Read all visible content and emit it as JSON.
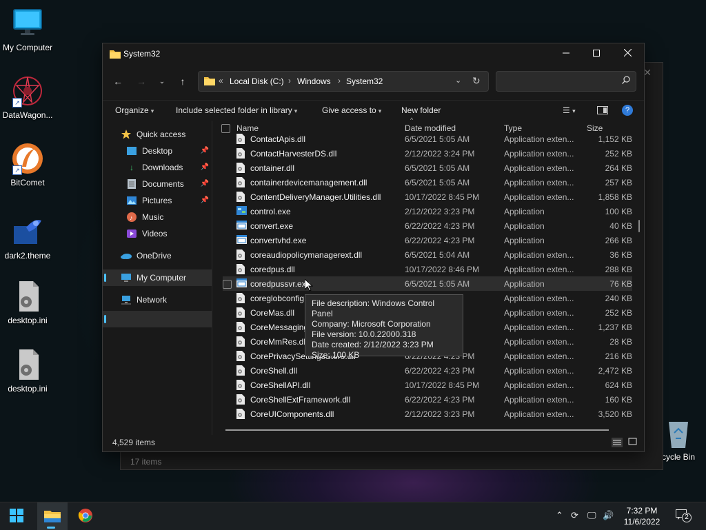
{
  "desktop": {
    "icons": [
      {
        "label": "My Computer",
        "icon": "monitor-icon"
      },
      {
        "label": "DataWagon...",
        "icon": "datawagon-icon"
      },
      {
        "label": "BitComet",
        "icon": "bitcomet-icon"
      },
      {
        "label": "dark2.theme",
        "icon": "theme-file-icon"
      },
      {
        "label": "desktop.ini",
        "icon": "settings-file-icon"
      },
      {
        "label": "desktop.ini",
        "icon": "settings-file-icon"
      },
      {
        "label": "cycle Bin",
        "icon": "recycle-bin-icon"
      }
    ]
  },
  "background_window": {
    "status": "17 items"
  },
  "window": {
    "title": "System32",
    "address": {
      "path": [
        "Local Disk (C:)",
        "Windows",
        "System32"
      ]
    },
    "search_placeholder": "",
    "commands": {
      "organize": "Organize",
      "include": "Include selected folder in library",
      "give_access": "Give access to",
      "new_folder": "New folder"
    },
    "sidebar": {
      "items": [
        {
          "label": "Quick access",
          "icon": "star-icon"
        },
        {
          "label": "Desktop",
          "icon": "desktop-icon",
          "pinned": true
        },
        {
          "label": "Downloads",
          "icon": "download-icon",
          "pinned": true
        },
        {
          "label": "Documents",
          "icon": "documents-icon",
          "pinned": true
        },
        {
          "label": "Pictures",
          "icon": "pictures-icon",
          "pinned": true
        },
        {
          "label": "Music",
          "icon": "music-icon"
        },
        {
          "label": "Videos",
          "icon": "videos-icon"
        },
        {
          "label": "OneDrive",
          "icon": "cloud-icon"
        },
        {
          "label": "My Computer",
          "icon": "computer-icon",
          "selected": true
        },
        {
          "label": "Network",
          "icon": "network-icon"
        }
      ]
    },
    "columns": {
      "name": "Name",
      "date": "Date modified",
      "type": "Type",
      "size": "Size"
    },
    "files": [
      {
        "name": "ContactApis.dll",
        "date": "6/5/2021 5:05 AM",
        "type": "Application exten...",
        "size": "1,152 KB",
        "kind": "dll"
      },
      {
        "name": "ContactHarvesterDS.dll",
        "date": "2/12/2022 3:24 PM",
        "type": "Application exten...",
        "size": "252 KB",
        "kind": "dll"
      },
      {
        "name": "container.dll",
        "date": "6/5/2021 5:05 AM",
        "type": "Application exten...",
        "size": "264 KB",
        "kind": "dll"
      },
      {
        "name": "containerdevicemanagement.dll",
        "date": "6/5/2021 5:05 AM",
        "type": "Application exten...",
        "size": "257 KB",
        "kind": "dll"
      },
      {
        "name": "ContentDeliveryManager.Utilities.dll",
        "date": "10/17/2022 8:45 PM",
        "type": "Application exten...",
        "size": "1,858 KB",
        "kind": "dll"
      },
      {
        "name": "control.exe",
        "date": "2/12/2022 3:23 PM",
        "type": "Application",
        "size": "100 KB",
        "kind": "control"
      },
      {
        "name": "convert.exe",
        "date": "6/22/2022 4:23 PM",
        "type": "Application",
        "size": "40 KB",
        "kind": "exe"
      },
      {
        "name": "convertvhd.exe",
        "date": "6/22/2022 4:23 PM",
        "type": "Application",
        "size": "266 KB",
        "kind": "exe"
      },
      {
        "name": "coreaudiopolicymanagerext.dll",
        "date": "6/5/2021 5:04 AM",
        "type": "Application exten...",
        "size": "36 KB",
        "kind": "dll"
      },
      {
        "name": "coredpus.dll",
        "date": "10/17/2022 8:46 PM",
        "type": "Application exten...",
        "size": "288 KB",
        "kind": "dll"
      },
      {
        "name": "coredpussvr.exe",
        "date": "6/5/2021 5:05 AM",
        "type": "Application",
        "size": "76 KB",
        "kind": "exe",
        "hover": true
      },
      {
        "name": "coreglobconfig",
        "date": "",
        "type": "Application exten...",
        "size": "240 KB",
        "kind": "dll"
      },
      {
        "name": "CoreMas.dll",
        "date": "",
        "type": "Application exten...",
        "size": "252 KB",
        "kind": "dll"
      },
      {
        "name": "CoreMessaging",
        "date": "",
        "type": "Application exten...",
        "size": "1,237 KB",
        "kind": "dll"
      },
      {
        "name": "CoreMmRes.dll",
        "date": "",
        "type": "Application exten...",
        "size": "28 KB",
        "kind": "dll"
      },
      {
        "name": "CorePrivacySettingsStore.dll",
        "date": "6/22/2022 4:23 PM",
        "type": "Application exten...",
        "size": "216 KB",
        "kind": "dll"
      },
      {
        "name": "CoreShell.dll",
        "date": "6/22/2022 4:23 PM",
        "type": "Application exten...",
        "size": "2,472 KB",
        "kind": "dll"
      },
      {
        "name": "CoreShellAPI.dll",
        "date": "10/17/2022 8:45 PM",
        "type": "Application exten...",
        "size": "624 KB",
        "kind": "dll"
      },
      {
        "name": "CoreShellExtFramework.dll",
        "date": "6/22/2022 4:23 PM",
        "type": "Application exten...",
        "size": "160 KB",
        "kind": "dll"
      },
      {
        "name": "CoreUIComponents.dll",
        "date": "2/12/2022 3:23 PM",
        "type": "Application exten...",
        "size": "3,520 KB",
        "kind": "dll"
      }
    ],
    "tooltip": {
      "description": "File description: Windows Control Panel",
      "company": "Company: Microsoft Corporation",
      "version": "File version: 10.0.22000.318",
      "created": "Date created: 2/12/2022 3:23 PM",
      "size": "Size: 100 KB"
    },
    "status": {
      "count": "4,529 items"
    }
  },
  "taskbar": {
    "time": "7:32 PM",
    "date": "11/6/2022",
    "notifications": "2"
  },
  "colors": {
    "accent": "#4cc2ff",
    "folder": "#f3c246",
    "window_bg": "#191919"
  }
}
